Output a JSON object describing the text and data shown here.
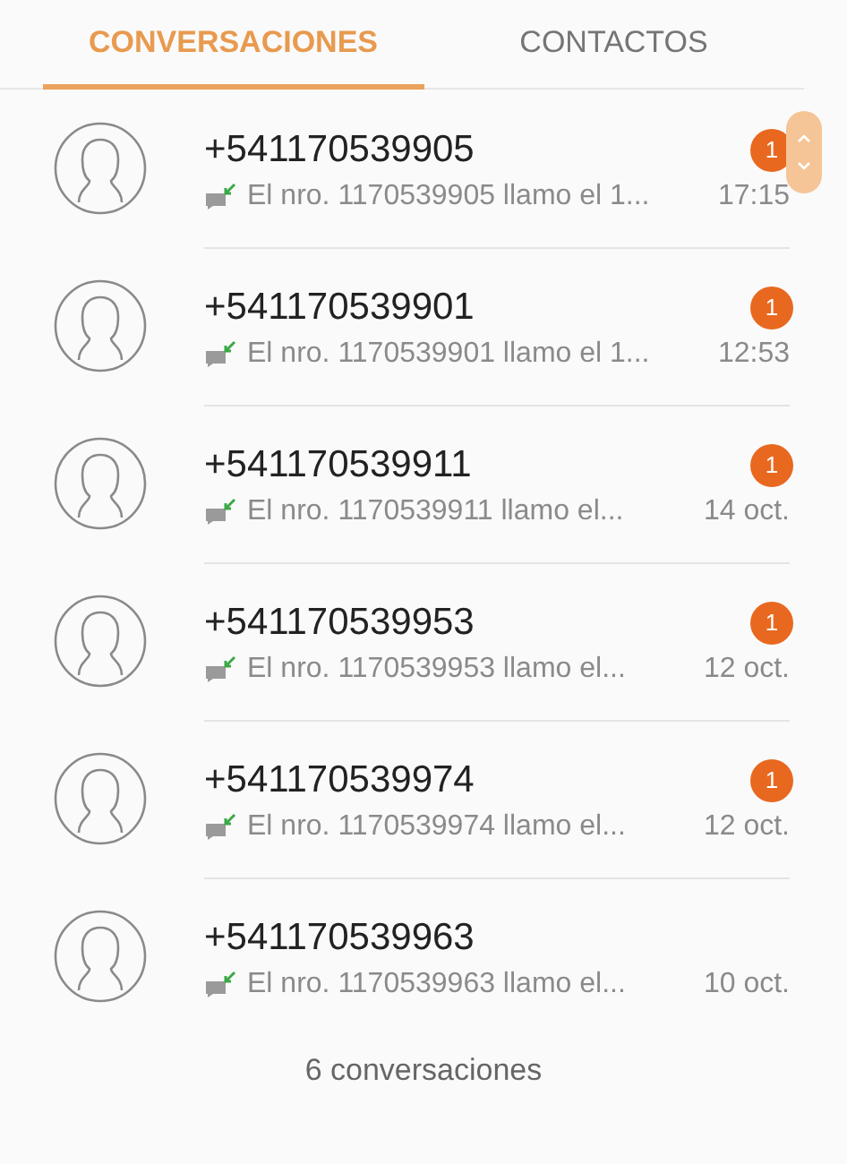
{
  "tabs": [
    {
      "label": "CONVERSACIONES",
      "selected": true
    },
    {
      "label": "CONTACTOS",
      "selected": false
    }
  ],
  "conversations": [
    {
      "name": "+541170539905",
      "preview": "El nro. 1170539905  llamo el 1...",
      "time": "17:15",
      "unread": "1"
    },
    {
      "name": "+541170539901",
      "preview": "El nro. 1170539901  llamo el 1...",
      "time": "12:53",
      "unread": "1"
    },
    {
      "name": "+541170539911",
      "preview": "El nro. 1170539911  llamo el...",
      "time": "14 oct.",
      "unread": "1"
    },
    {
      "name": "+541170539953",
      "preview": "El nro. 1170539953  llamo el...",
      "time": "12 oct.",
      "unread": "1"
    },
    {
      "name": "+541170539974",
      "preview": "El nro. 1170539974  llamo el...",
      "time": "12 oct.",
      "unread": "1"
    },
    {
      "name": "+541170539963",
      "preview": "El nro. 1170539963  llamo el...",
      "time": "10 oct."
    }
  ],
  "footer": "6 conversaciones"
}
